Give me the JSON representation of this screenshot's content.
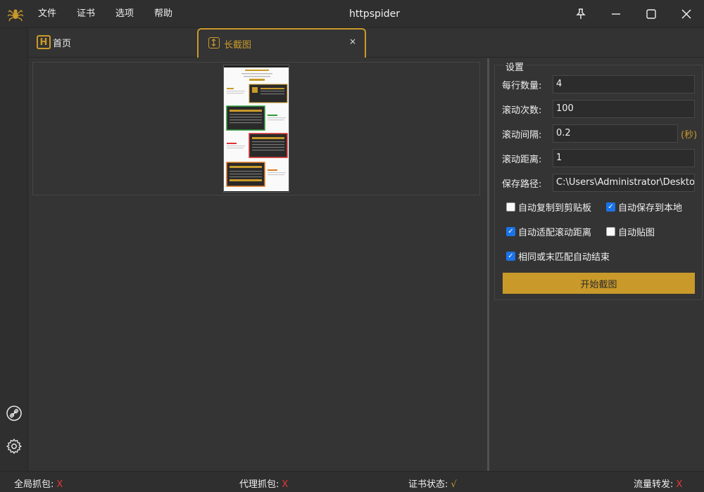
{
  "app": {
    "title": "httpspider"
  },
  "menu": {
    "items": [
      "文件",
      "证书",
      "选项",
      "帮助"
    ]
  },
  "tabs": {
    "home_label": "首页",
    "active_label": "长截图",
    "close_glyph": "×"
  },
  "settings": {
    "title": "设置",
    "per_row_label": "每行数量:",
    "per_row_value": "4",
    "scroll_count_label": "滚动次数:",
    "scroll_count_value": "100",
    "scroll_interval_label": "滚动间隔:",
    "scroll_interval_value": "0.2",
    "scroll_interval_unit": "(秒)",
    "scroll_distance_label": "滚动距离:",
    "scroll_distance_value": "1",
    "save_path_label": "保存路径:",
    "save_path_value": "C:\\Users\\Administrator\\Desktop\\h",
    "checkboxes": [
      {
        "label": "自动复制到剪贴板",
        "checked": false
      },
      {
        "label": "自动保存到本地",
        "checked": true
      },
      {
        "label": "自动适配滚动距离",
        "checked": true
      },
      {
        "label": "自动贴图",
        "checked": false
      },
      {
        "label": "相同或末匹配自动结束",
        "checked": true
      }
    ],
    "start_button": "开始截图"
  },
  "status": {
    "global_capture_label": "全局抓包:",
    "global_capture_value": "X",
    "proxy_capture_label": "代理抓包:",
    "proxy_capture_value": "X",
    "cert_status_label": "证书状态:",
    "cert_status_value": "√",
    "traffic_forward_label": "流量转发:",
    "traffic_forward_value": "X"
  },
  "colors": {
    "accent": "#c99a2a",
    "error": "#e53935",
    "ok": "#c99a2a",
    "checkbox": "#1a73e8",
    "background": "#343434"
  },
  "icons": [
    "spider-logo-icon",
    "pin-icon",
    "minimize-icon",
    "maximize-icon",
    "close-icon",
    "link-icon",
    "gear-icon",
    "home-h-icon",
    "long-screenshot-icon"
  ]
}
